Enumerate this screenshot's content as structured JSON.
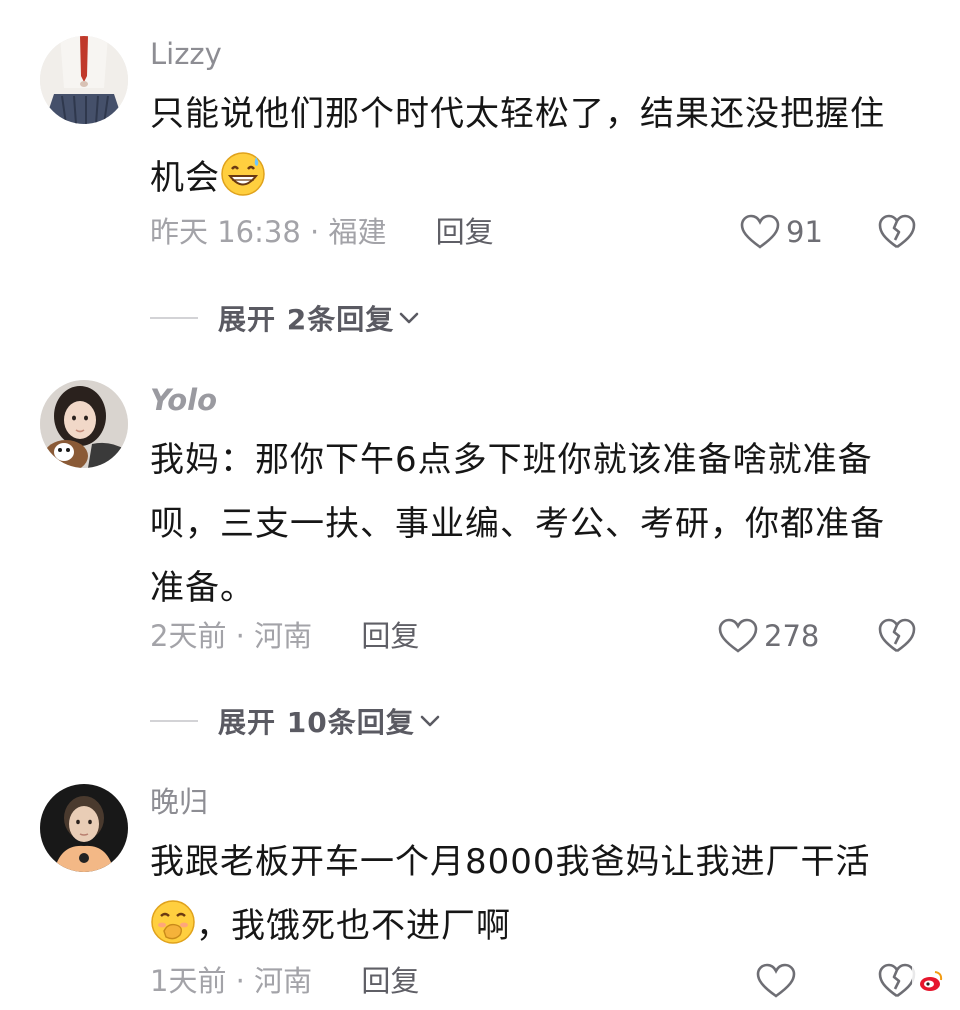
{
  "comments": [
    {
      "username": "Lizzy",
      "content_lines": [
        "只能说他们那个时代太轻松了，结果还没把握住",
        "机会"
      ],
      "emoji": "grinning-sweat-emoji",
      "time": "昨天 16:38 · 福建",
      "reply_label": "回复",
      "likes": "91",
      "expand": "展开 2条回复"
    },
    {
      "username": "Yolo",
      "content_lines": [
        "我妈：那你下午6点多下班你就该准备啥就准备",
        "呗，三支一扶、事业编、考公、考研，你都准备",
        "准备。"
      ],
      "time": "2天前 · 河南",
      "reply_label": "回复",
      "likes": "278",
      "expand": "展开 10条回复"
    },
    {
      "username": "晚归",
      "content_lines": [
        "我跟老板开车一个月8000我爸妈让我进厂干活",
        "，我饿死也不进厂啊"
      ],
      "emoji": "hand-over-mouth-emoji",
      "time": "1天前 · 河南",
      "reply_label": "回复"
    }
  ],
  "colors": {
    "text": "#161616",
    "meta": "#a3a3a8",
    "accent_gray": "#5a5a62"
  }
}
